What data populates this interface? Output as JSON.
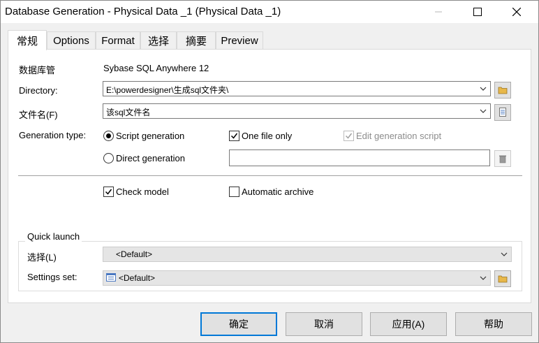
{
  "window": {
    "title": "Database Generation - Physical Data _1 (Physical Data _1)"
  },
  "tabs": [
    {
      "label": "常规",
      "active": true
    },
    {
      "label": "Options",
      "active": false
    },
    {
      "label": "Format",
      "active": false
    },
    {
      "label": "选择",
      "active": false
    },
    {
      "label": "摘要",
      "active": false
    },
    {
      "label": "Preview",
      "active": false
    }
  ],
  "general": {
    "dbms_label": "数据库管",
    "dbms_value": "Sybase SQL Anywhere 12",
    "directory_label": "Directory:",
    "directory_value": "E:\\powerdesigner\\生成sql文件夹\\",
    "filename_label": "文件名(F)",
    "filename_value": "该sql文件名",
    "gentype_label": "Generation type:",
    "script_generation": "Script generation",
    "direct_generation": "Direct generation",
    "one_file_only": "One file only",
    "edit_generation_script": "Edit generation script",
    "check_model": "Check model",
    "automatic_archive": "Automatic archive"
  },
  "states": {
    "script_generation_selected": true,
    "direct_generation_selected": false,
    "one_file_only_checked": true,
    "edit_generation_script_checked": true,
    "check_model_checked": true,
    "automatic_archive_checked": false
  },
  "quick_launch": {
    "title": "Quick launch",
    "selection_label": "选择(L)",
    "selection_value": "<Default>",
    "settings_label": "Settings set:",
    "settings_value": "<Default>"
  },
  "buttons": {
    "ok": "确定",
    "cancel": "取消",
    "apply": "应用(A)",
    "help": "帮助"
  },
  "colors": {
    "accent": "#0078d7",
    "folder_icon": "#e8b84a"
  },
  "icons": {
    "dir_browse": "folder-icon",
    "file_browse": "document-icon",
    "direct_gen": "trash-icon",
    "settings_browse": "folder-icon",
    "settings_set": "list-icon"
  }
}
